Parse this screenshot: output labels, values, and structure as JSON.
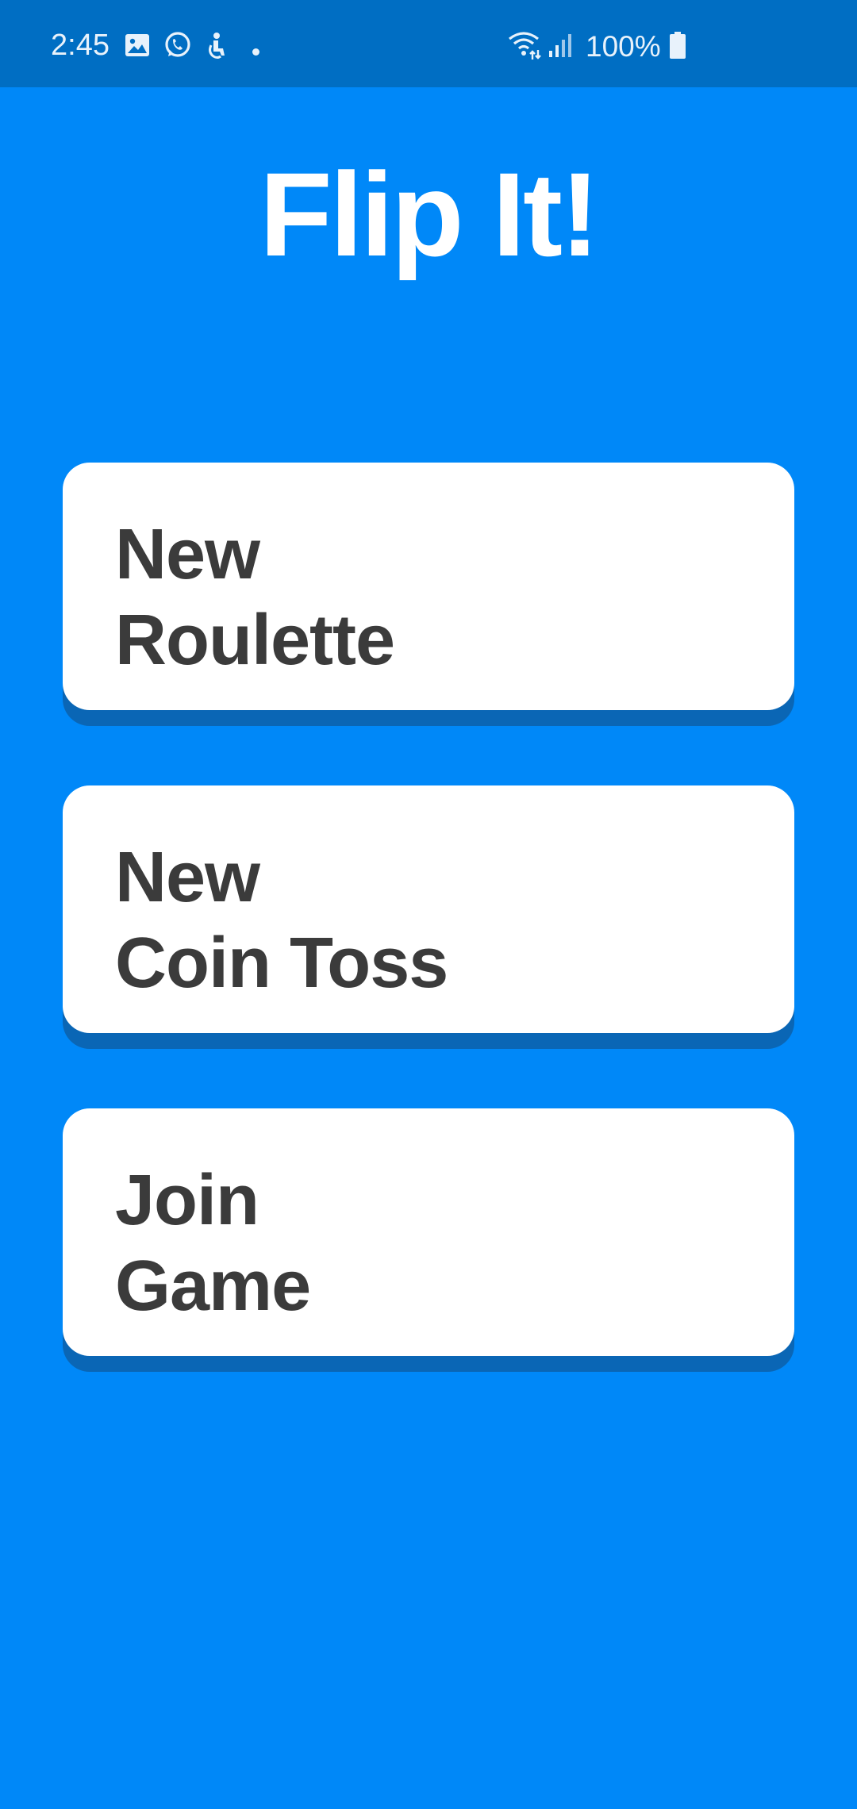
{
  "status_bar": {
    "time": "2:45",
    "battery_percent": "100%",
    "icons": [
      "gallery-icon",
      "whatsapp-icon",
      "accessibility-icon",
      "wifi-icon",
      "signal-icon",
      "battery-icon"
    ]
  },
  "app": {
    "title": "Flip It!"
  },
  "menu": {
    "items": [
      {
        "line1": "New",
        "line2": "Roulette"
      },
      {
        "line1": "New",
        "line2": "Coin Toss"
      },
      {
        "line1": "Join",
        "line2": "Game"
      }
    ]
  },
  "colors": {
    "background": "#0088f8",
    "status_bar": "#006ec3",
    "card": "#ffffff",
    "card_text": "#3b3b3b",
    "card_shadow": "#0a66b5"
  }
}
